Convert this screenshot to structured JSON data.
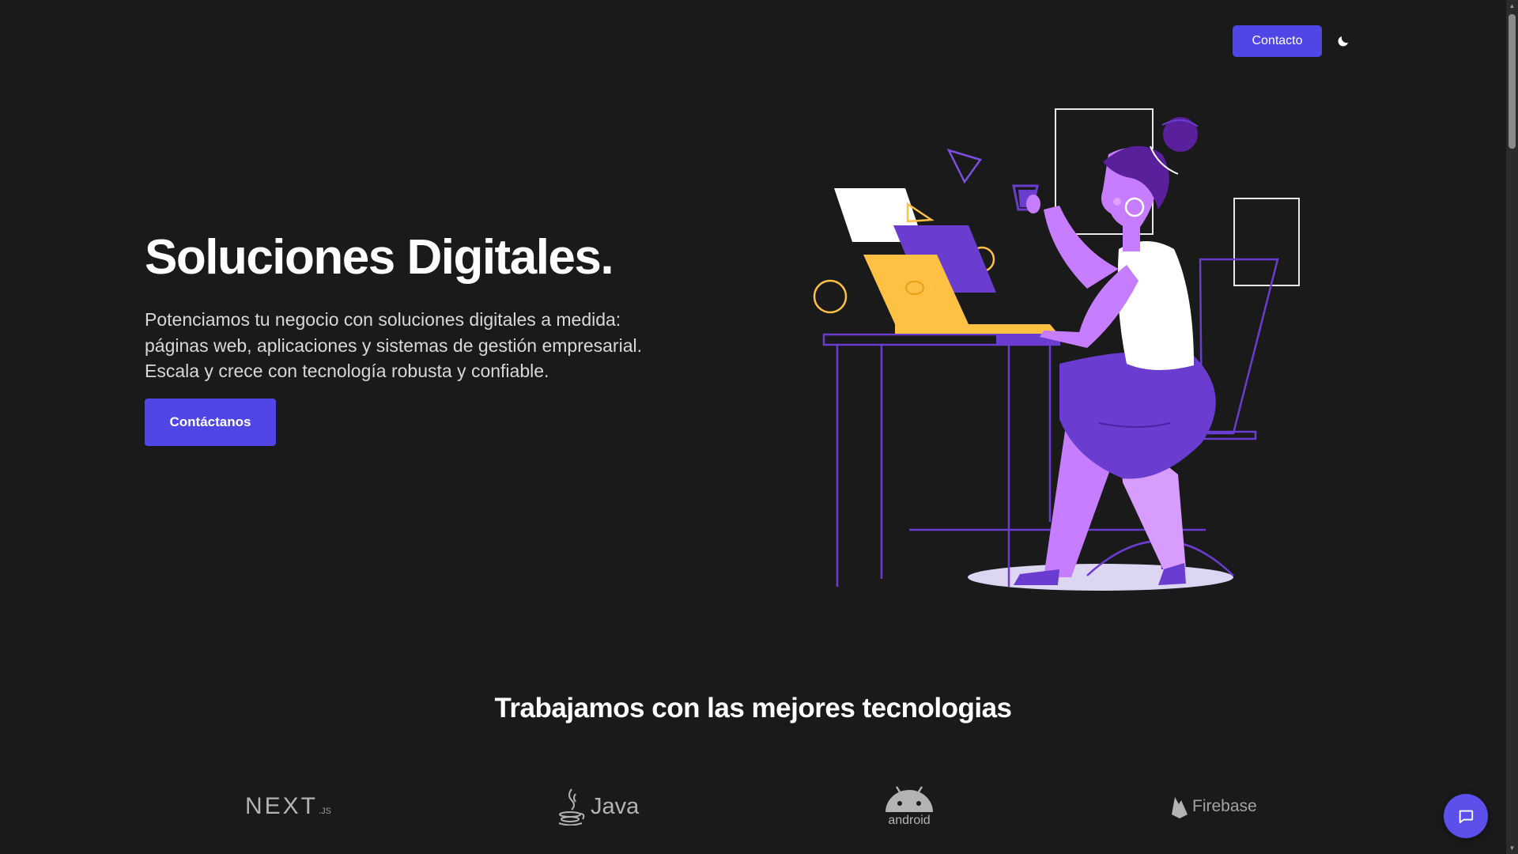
{
  "header": {
    "contact_label": "Contacto",
    "theme_icon": "moon-icon"
  },
  "hero": {
    "title": "Soluciones Digitales.",
    "description_lines": [
      "Potenciamos tu negocio con soluciones digitales a medida:",
      "páginas web, aplicaciones y sistemas de gestión empresarial.",
      "Escala y crece con tecnología robusta y confiable."
    ],
    "cta_label": "Contáctanos",
    "illustration": "woman-at-desk-illustration"
  },
  "technologies": {
    "heading": "Trabajamos con las mejores tecnologias",
    "logos": [
      {
        "name": "NEXT",
        "suffix": ".JS",
        "icon": "nextjs-logo"
      },
      {
        "name": "Java",
        "icon": "java-logo"
      },
      {
        "name": "android",
        "icon": "android-logo"
      },
      {
        "name": "Firebase",
        "icon": "firebase-logo"
      }
    ]
  },
  "chat": {
    "icon": "chat-bubble-icon"
  },
  "colors": {
    "background": "#1a1a1b",
    "accent": "#4f46e5",
    "illustration_purple": "#c77dff",
    "illustration_dark_purple": "#6a3cd0",
    "illustration_yellow": "#ffc144"
  }
}
